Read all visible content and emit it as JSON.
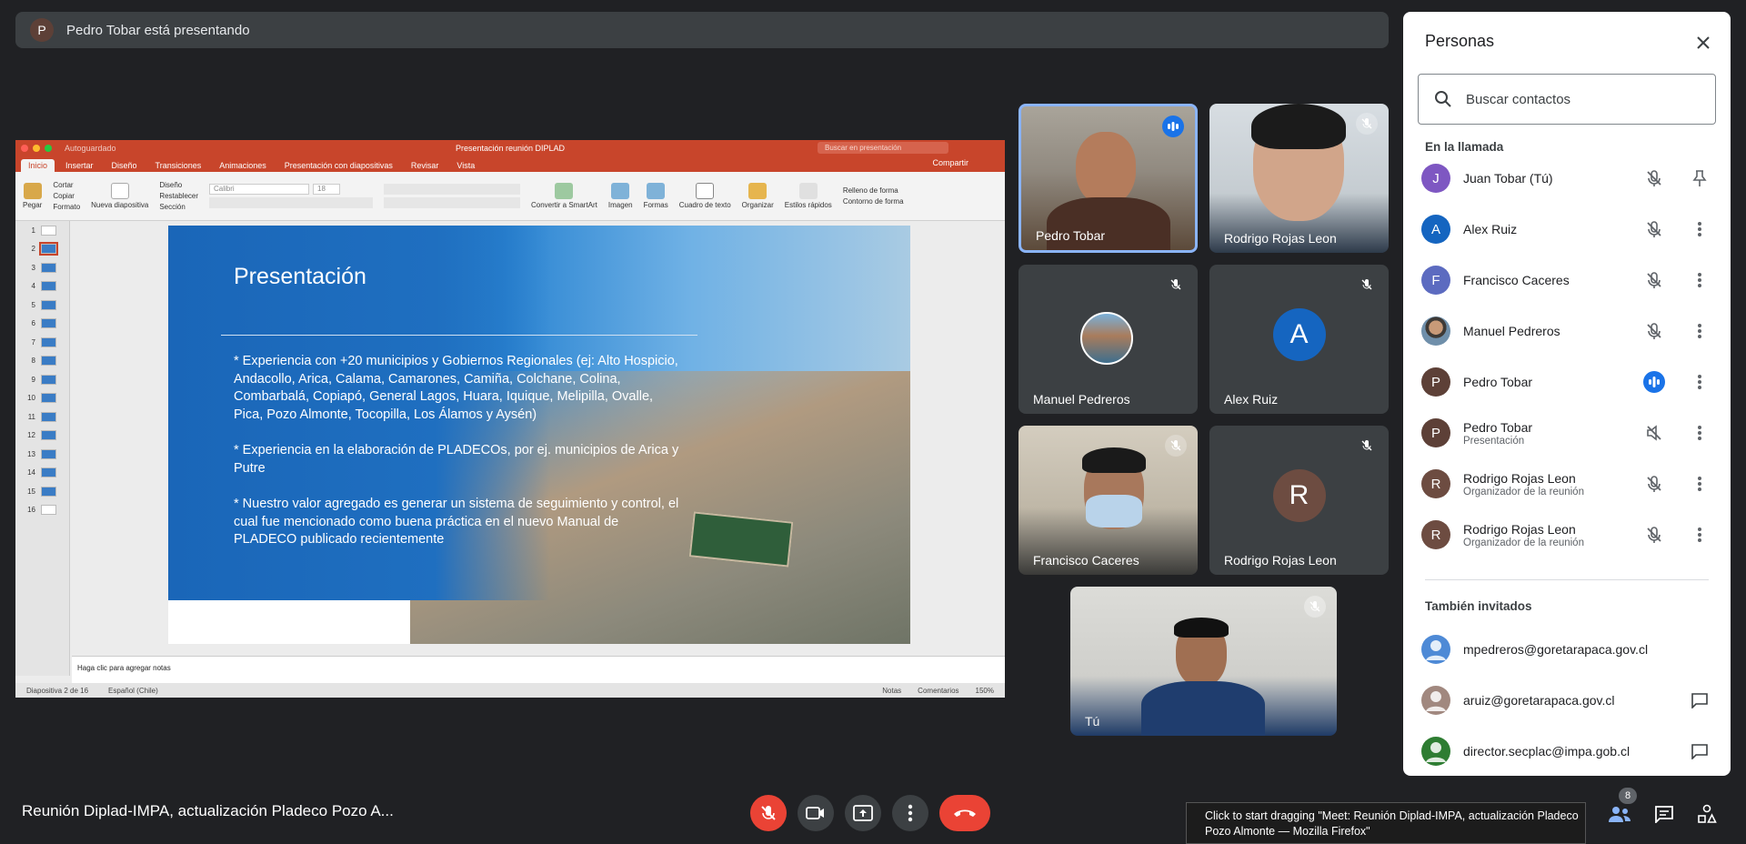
{
  "banner": {
    "avatar_letter": "P",
    "text": "Pedro Tobar está presentando"
  },
  "ppt": {
    "window_title": "Presentación reunión DIPLAD",
    "search_placeholder": "Buscar en presentación",
    "autosave_label": "Autoguardado",
    "tabs": [
      "Inicio",
      "Insertar",
      "Diseño",
      "Transiciones",
      "Animaciones",
      "Presentación con diapositivas",
      "Revisar",
      "Vista"
    ],
    "share_label": "Compartir",
    "ribbon": {
      "paste": "Pegar",
      "cut": "Cortar",
      "copy": "Copiar",
      "format": "Formato",
      "new_slide": "Nueva diapositiva",
      "layout": "Diseño",
      "reset": "Restablecer",
      "section": "Sección",
      "font": "Calibri",
      "size": "18",
      "convert": "Convertir a SmartArt",
      "image": "Imagen",
      "shapes": "Formas",
      "textbox": "Cuadro de texto",
      "arrange": "Organizar",
      "quick_styles": "Estilos rápidos",
      "fill": "Relleno de forma",
      "outline": "Contorno de forma"
    },
    "slide_numbers": [
      "1",
      "2",
      "3",
      "4",
      "5",
      "6",
      "7",
      "8",
      "9",
      "10",
      "11",
      "12",
      "13",
      "14",
      "15",
      "16"
    ],
    "selected_slide": 2,
    "slide": {
      "title": "Presentación",
      "p1": "* Experiencia con +20 municipios y Gobiernos Regionales (ej: Alto Hospicio, Andacollo, Arica, Calama, Camarones, Camiña, Colchane, Colina, Combarbalá, Copiapó, General Lagos, Huara, Iquique, Melipilla, Ovalle, Pica, Pozo Almonte, Tocopilla, Los Álamos y Aysén)",
      "p2": "* Experiencia en la elaboración de PLADECOs, por ej. municipios de Arica y Putre",
      "p3": "* Nuestro valor agregado es generar un sistema de seguimiento y control, el cual fue mencionado como buena práctica en el nuevo Manual de PLADECO publicado recientemente"
    },
    "notes_placeholder": "Haga clic para agregar notas",
    "status": {
      "slide_info": "Diapositiva 2 de 16",
      "language": "Español (Chile)",
      "notes": "Notas",
      "comments": "Comentarios",
      "zoom": "150%"
    }
  },
  "tiles": {
    "pedro": "Pedro Tobar",
    "rodrigo_video": "Rodrigo Rojas Leon",
    "manuel": "Manuel Pedreros",
    "alex": "Alex Ruiz",
    "alex_letter": "A",
    "francisco": "Francisco Caceres",
    "rodrigo": "Rodrigo Rojas Leon",
    "rodrigo_letter": "R",
    "self": "Tú"
  },
  "panel": {
    "title": "Personas",
    "search_placeholder": "Buscar contactos",
    "in_call_label": "En la llamada",
    "also_invited_label": "También invitados",
    "participants": [
      {
        "letter": "J",
        "name": "Juan Tobar (Tú)",
        "role": "",
        "color": "#7e57c2"
      },
      {
        "letter": "A",
        "name": "Alex Ruiz",
        "role": "",
        "color": "#1565c0"
      },
      {
        "letter": "F",
        "name": "Francisco Caceres",
        "role": "",
        "color": "#5c6bc0"
      },
      {
        "letter": "",
        "name": "Manuel Pedreros",
        "role": "",
        "color": "#8d6e63"
      },
      {
        "letter": "P",
        "name": "Pedro Tobar",
        "role": "",
        "color": "#5d4037"
      },
      {
        "letter": "P",
        "name": "Pedro Tobar",
        "role": "Presentación",
        "color": "#5d4037"
      },
      {
        "letter": "R",
        "name": "Rodrigo Rojas Leon",
        "role": "Organizador de la reunión",
        "color": "#6d4c41"
      },
      {
        "letter": "R",
        "name": "Rodrigo Rojas Leon",
        "role": "Organizador de la reunión",
        "color": "#6d4c41"
      }
    ],
    "invited": [
      {
        "email": "mpedreros@goretarapaca.gov.cl"
      },
      {
        "email": "aruiz@goretarapaca.gov.cl"
      },
      {
        "email": "director.secplac@impa.gob.cl"
      }
    ]
  },
  "bottom": {
    "meeting_name": "Reunión Diplad-IMPA, actualización Pladeco Pozo A...",
    "tooltip": "Click to start dragging \"Meet: Reunión Diplad-IMPA, actualización Pladeco Pozo Almonte — Mozilla Firefox\"",
    "people_count": "8"
  },
  "colors": {
    "accent": "#1a73e8",
    "danger": "#ea4335",
    "ppt": "#c8452b",
    "bg": "#202124",
    "tile": "#3c4043"
  }
}
